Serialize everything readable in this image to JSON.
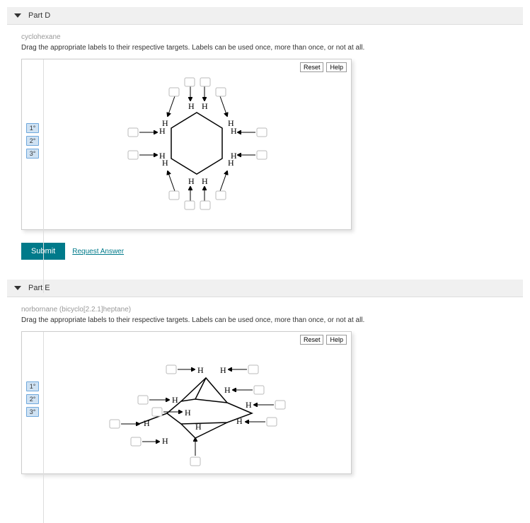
{
  "partD": {
    "header": "Part D",
    "subtitle": "cyclohexane",
    "instruction": "Drag the appropriate labels to their respective targets. Labels can be used once, more than once, or not at all.",
    "toolbar": {
      "reset": "Reset",
      "help": "Help"
    },
    "labels": [
      "1°",
      "2°",
      "3°"
    ],
    "drop_count": 12,
    "h_labels": [
      "H",
      "H",
      "H",
      "H",
      "H",
      "H",
      "H",
      "H",
      "H",
      "H",
      "H",
      "H"
    ],
    "submit": "Submit",
    "request_answer": "Request Answer"
  },
  "partE": {
    "header": "Part E",
    "subtitle": "norbornane (bicyclo[2.2.1]heptane)",
    "instruction": "Drag the appropriate labels to their respective targets. Labels can be used once, more than once, or not at all.",
    "toolbar": {
      "reset": "Reset",
      "help": "Help"
    },
    "labels": [
      "1°",
      "2°",
      "3°"
    ],
    "drop_count": 10,
    "h_labels": [
      "H",
      "H",
      "H",
      "H",
      "H",
      "H",
      "H",
      "H",
      "H",
      "H"
    ]
  },
  "chart_data": [
    {
      "type": "diagram",
      "name": "cyclohexane",
      "ring_carbons": 6,
      "hydrogens_shown": 12,
      "drop_targets": 12,
      "anchor": "Part D"
    },
    {
      "type": "diagram",
      "name": "norbornane (bicyclo[2.2.1]heptane)",
      "ring_carbons": 7,
      "hydrogens_shown": 10,
      "drop_targets": 10,
      "anchor": "Part E"
    }
  ]
}
